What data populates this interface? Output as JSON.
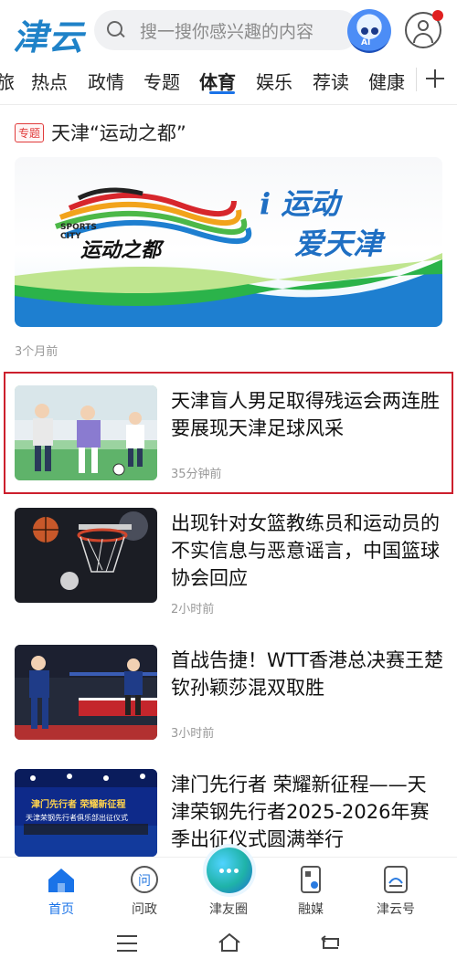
{
  "header": {
    "logo": "津云",
    "search_placeholder": "搜一搜你感兴趣的内容",
    "ai_label": "AI",
    "icons": [
      "search-icon",
      "ai-robot-icon",
      "profile-icon"
    ]
  },
  "tabs": [
    "旅",
    "热点",
    "政情",
    "专题",
    "体育",
    "娱乐",
    "荐读",
    "健康"
  ],
  "active_tab": "体育",
  "feature": {
    "badge": "专题",
    "title": "天津“运动之都”",
    "banner_sports_city": "SPORTS CITY",
    "banner_cn": "运动之都",
    "slogan_line1": "i 运动",
    "slogan_line2": "爱天津",
    "time": "3个月前"
  },
  "articles": [
    {
      "title": "天津盲人男足取得残运会两连胜 要展现天津足球风采",
      "time": "35分钟前",
      "highlighted": true
    },
    {
      "title": "出现针对女篮教练员和运动员的不实信息与恶意谣言，中国篮球协会回应",
      "time": "2小时前"
    },
    {
      "title": "首战告捷！WTT香港总决赛王楚钦孙颖莎混双取胜",
      "time": "3小时前"
    },
    {
      "title": "津门先行者 荣耀新征程——天津荣钢先行者2025-2026年赛季出征仪式圆满举行",
      "time": ""
    }
  ],
  "thumb_text": {
    "event_title": "津门先行者 荣耀新征程",
    "event_subtitle": "天津荣钢先行者俱乐部出征仪式"
  },
  "bottom_nav": [
    {
      "label": "首页",
      "icon": "home-icon",
      "active": true
    },
    {
      "label": "问政",
      "icon": "question-icon",
      "active": false
    },
    {
      "label": "津友圈",
      "icon": "chat-bubble-icon",
      "active": false
    },
    {
      "label": "融媒",
      "icon": "media-icon",
      "active": false
    },
    {
      "label": "津云号",
      "icon": "account-icon",
      "active": false
    }
  ],
  "colors": {
    "accent": "#1a73e8",
    "brand": "#1f82c8",
    "highlight_border": "#cc1f2d",
    "badge": "#e03b3b"
  }
}
